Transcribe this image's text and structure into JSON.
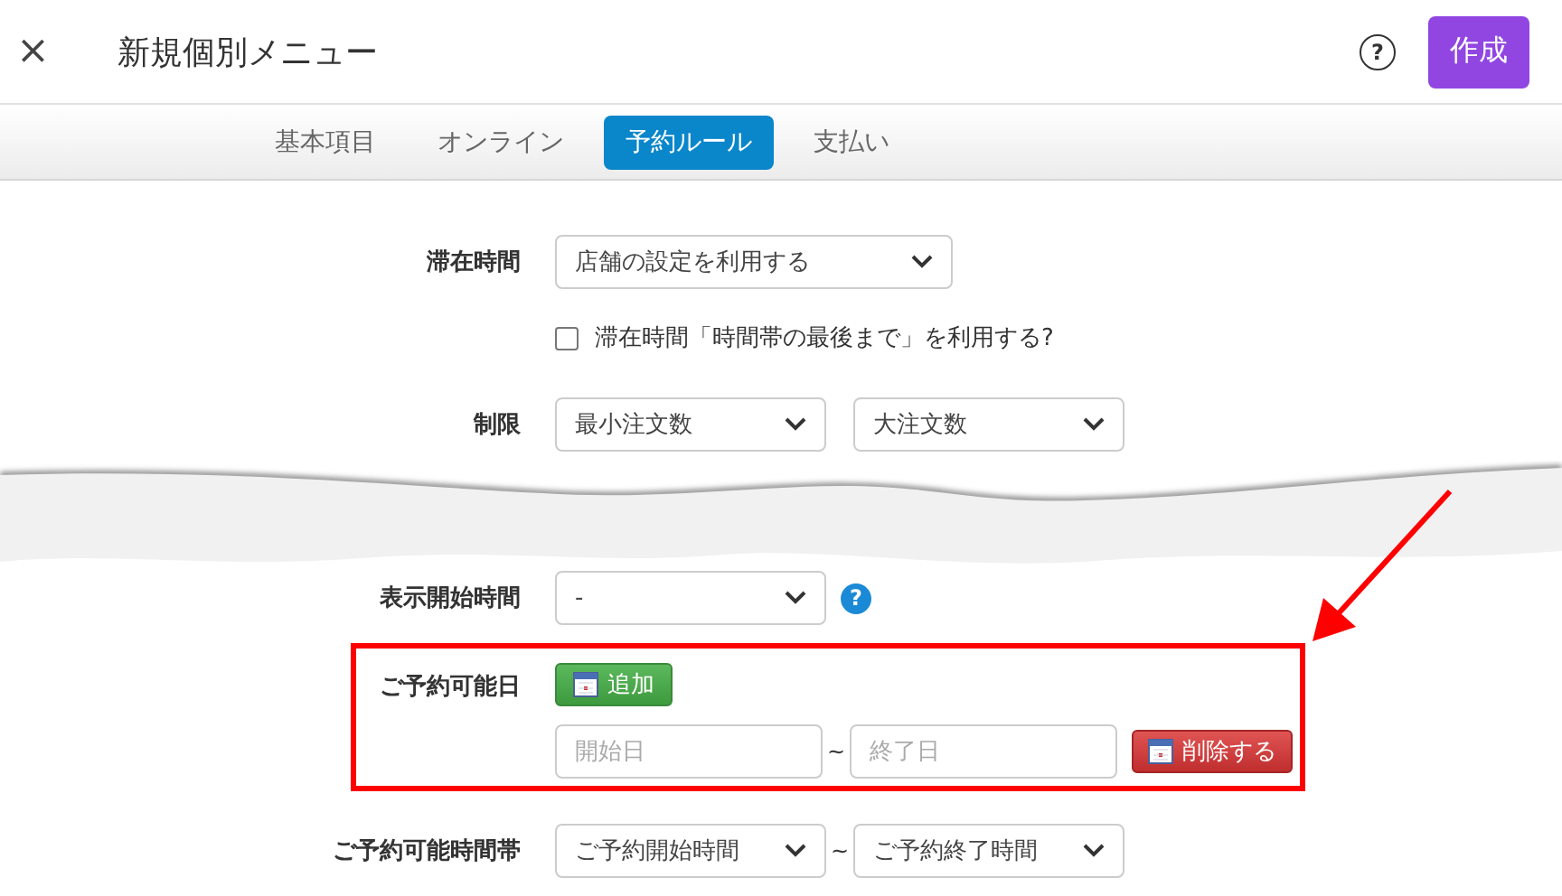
{
  "header": {
    "close": "×",
    "title": "新規個別メニュー",
    "help": "?",
    "create_button": "作成"
  },
  "tabs": [
    {
      "label": "基本項目",
      "selected": false
    },
    {
      "label": "オンライン",
      "selected": false
    },
    {
      "label": "予約ルール",
      "selected": true
    },
    {
      "label": "支払い",
      "selected": false
    }
  ],
  "form": [
    {
      "kind": "select",
      "label": "滞在時間",
      "value": "店舗の設定を利用する"
    },
    {
      "kind": "checkbox",
      "text": "滞在時間「時間帯の最後まで」を利用する?",
      "checked": false
    },
    {
      "kind": "range_select",
      "label": "制限",
      "from": "最小注文数",
      "to": "大注文数"
    },
    {
      "kind": "select_help",
      "label": "表示開始時間",
      "value": "-",
      "help": "?"
    },
    {
      "kind": "date_range",
      "label": "ご予約可能日",
      "add_button": "追加",
      "start_placeholder": "開始日",
      "separator": "~",
      "end_placeholder": "終了日",
      "delete_button": "削除する",
      "highlighted": true
    },
    {
      "kind": "range_select",
      "label": "ご予約可能時間帯",
      "from": "ご予約開始時間",
      "separator": "~",
      "to": "ご予約終了時間"
    }
  ]
}
